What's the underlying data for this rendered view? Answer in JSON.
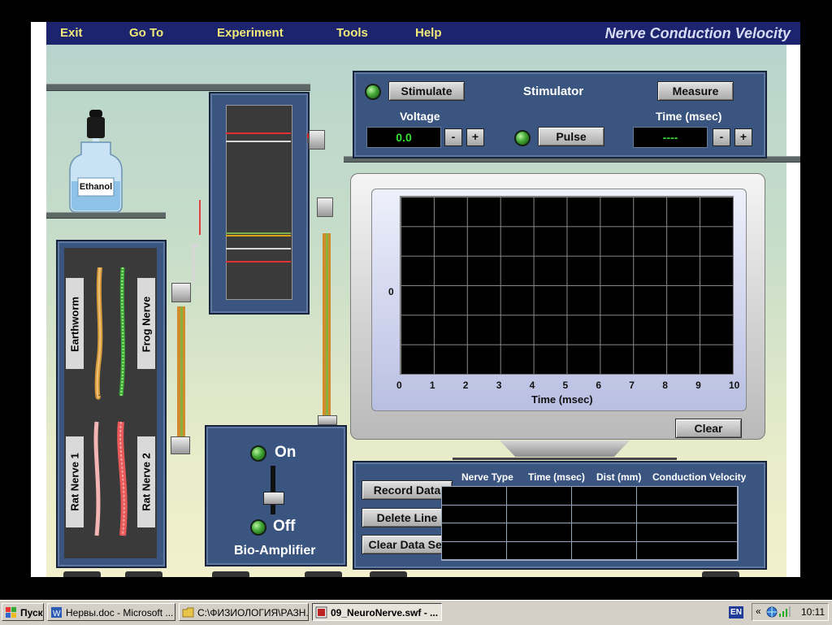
{
  "menu": {
    "exit": "Exit",
    "goto": "Go To",
    "experiment": "Experiment",
    "tools": "Tools",
    "help": "Help"
  },
  "app_title": "Nerve Conduction Velocity",
  "bottle_label": "Ethanol",
  "nerves": {
    "earthworm": "Earthworm",
    "frog": "Frog Nerve",
    "rat1": "Rat Nerve 1",
    "rat2": "Rat Nerve 2"
  },
  "stimulator": {
    "stimulate_label": "Stimulate",
    "title": "Stimulator",
    "measure_label": "Measure",
    "voltage_label": "Voltage",
    "voltage_value": "0.0",
    "time_label": "Time (msec)",
    "time_value": "----",
    "pulse_label": "Pulse",
    "minus": "-",
    "plus": "+"
  },
  "oscilloscope": {
    "y_zero": "0",
    "x_ticks": [
      "0",
      "1",
      "2",
      "3",
      "4",
      "5",
      "6",
      "7",
      "8",
      "9",
      "10"
    ],
    "x_label": "Time (msec)",
    "clear_label": "Clear"
  },
  "amplifier": {
    "on": "On",
    "off": "Off",
    "title": "Bio-Amplifier"
  },
  "data_panel": {
    "record": "Record Data",
    "delete": "Delete Line",
    "clear_set": "Clear Data Set",
    "columns": [
      "Nerve Type",
      "Time (msec)",
      "Dist (mm)",
      "Conduction Velocity"
    ]
  },
  "taskbar": {
    "start": "Пуск",
    "task1": "Нервы.doc - Microsoft ...",
    "task2": "C:\\ФИЗИОЛОГИЯ\\РАЗН...",
    "task3": "09_NeuroNerve.swf - ...",
    "lang": "EN",
    "chevron": "«",
    "clock": "10:11"
  }
}
